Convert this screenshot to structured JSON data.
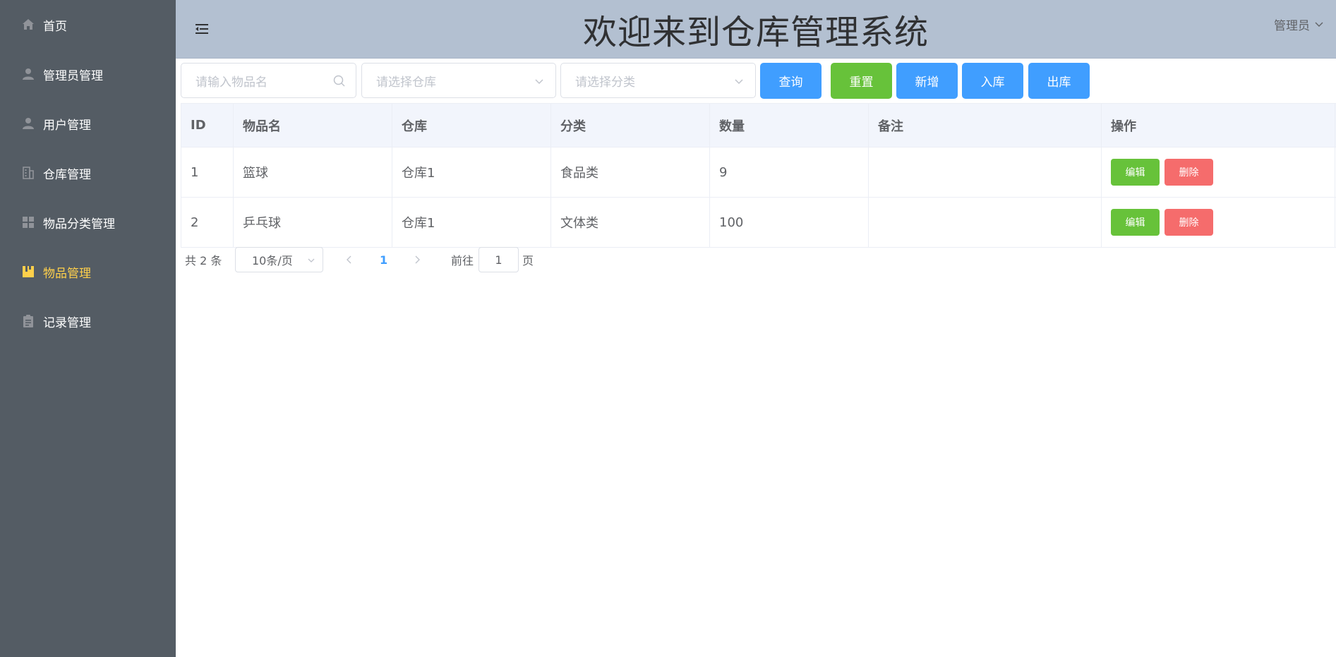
{
  "header": {
    "title": "欢迎来到仓库管理系统",
    "user": "管理员"
  },
  "sidebar": {
    "items": [
      {
        "label": "首页",
        "icon": "home-icon"
      },
      {
        "label": "管理员管理",
        "icon": "user-icon"
      },
      {
        "label": "用户管理",
        "icon": "user-icon"
      },
      {
        "label": "仓库管理",
        "icon": "building-icon"
      },
      {
        "label": "物品分类管理",
        "icon": "grid-icon"
      },
      {
        "label": "物品管理",
        "icon": "folder-icon",
        "active": true
      },
      {
        "label": "记录管理",
        "icon": "clipboard-icon"
      }
    ]
  },
  "toolbar": {
    "name_placeholder": "请输入物品名",
    "storage_placeholder": "请选择仓库",
    "category_placeholder": "请选择分类",
    "query_label": "查询",
    "reset_label": "重置",
    "add_label": "新增",
    "in_label": "入库",
    "out_label": "出库"
  },
  "table": {
    "columns": [
      "ID",
      "物品名",
      "仓库",
      "分类",
      "数量",
      "备注",
      "操作"
    ],
    "rows": [
      {
        "id": "1",
        "name": "篮球",
        "storage": "仓库1",
        "category": "食品类",
        "count": "9",
        "remark": ""
      },
      {
        "id": "2",
        "name": "乒乓球",
        "storage": "仓库1",
        "category": "文体类",
        "count": "100",
        "remark": ""
      }
    ],
    "edit_label": "编辑",
    "delete_label": "删除"
  },
  "pagination": {
    "total_text": "共 2 条",
    "page_size": "10条/页",
    "current_page": "1",
    "goto_label": "前往",
    "goto_value": "1",
    "page_suffix": "页"
  },
  "colors": {
    "sidebar_bg": "#545c64",
    "sidebar_active": "#ffd04b",
    "header_bg": "#b3c0d1",
    "primary": "#409eff",
    "success": "#67c23a",
    "danger": "#f56c6c"
  }
}
